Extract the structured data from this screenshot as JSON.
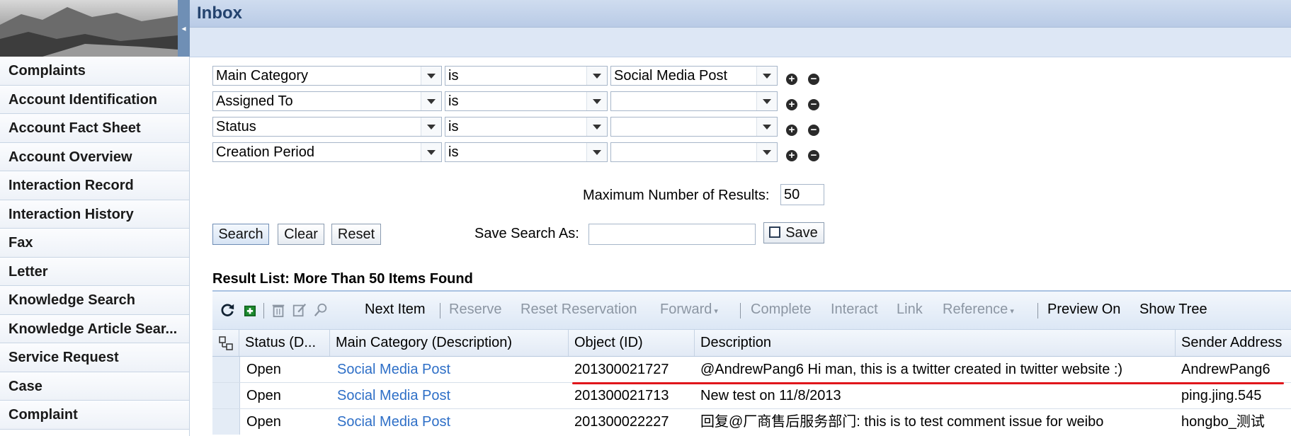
{
  "header": {
    "title": "Inbox"
  },
  "nav": {
    "items": [
      "Complaints",
      "Account Identification",
      "Account Fact Sheet",
      "Account Overview",
      "Interaction Record",
      "Interaction History",
      "Fax",
      "Letter",
      "Knowledge Search",
      "Knowledge Article Sear...",
      "Service Request",
      "Case",
      "Complaint"
    ]
  },
  "criteria": [
    {
      "field": "Main Category",
      "operator": "is",
      "value": "Social Media Post"
    },
    {
      "field": "Assigned To",
      "operator": "is",
      "value": ""
    },
    {
      "field": "Status",
      "operator": "is",
      "value": ""
    },
    {
      "field": "Creation Period",
      "operator": "is",
      "value": ""
    }
  ],
  "search": {
    "max_results_label": "Maximum Number of Results:",
    "max_results_value": "50",
    "search_label": "Search",
    "clear_label": "Clear",
    "reset_label": "Reset",
    "save_as_label": "Save Search As:",
    "save_as_value": "",
    "save_label": "Save"
  },
  "results": {
    "title": "Result List: More Than 50 Items Found",
    "toolbar": {
      "next_item": "Next Item",
      "reserve": "Reserve",
      "reset_reservation": "Reset Reservation",
      "forward": "Forward",
      "complete": "Complete",
      "interact": "Interact",
      "link": "Link",
      "reference": "Reference",
      "preview_on": "Preview On",
      "show_tree": "Show Tree"
    },
    "columns": [
      "Status (D...",
      "Main Category (Description)",
      "Object (ID)",
      "Description",
      "Sender Address"
    ],
    "rows": [
      {
        "status": "Open",
        "category": "Social Media Post",
        "object_id": "201300021727",
        "description": "@AndrewPang6 Hi man, this is a twitter created in twitter website :)",
        "sender": "AndrewPang6"
      },
      {
        "status": "Open",
        "category": "Social Media Post",
        "object_id": "201300021713",
        "description": "New test on 11/8/2013",
        "sender": "ping.jing.545"
      },
      {
        "status": "Open",
        "category": "Social Media Post",
        "object_id": "201300022227",
        "description": "回复@厂商售后服务部门: this is to test comment issue for weibo",
        "sender": "hongbo_测试"
      }
    ]
  },
  "colors": {
    "link": "#2e6fc7",
    "highlight_underline": "#e0161b",
    "title": "#24436e"
  }
}
